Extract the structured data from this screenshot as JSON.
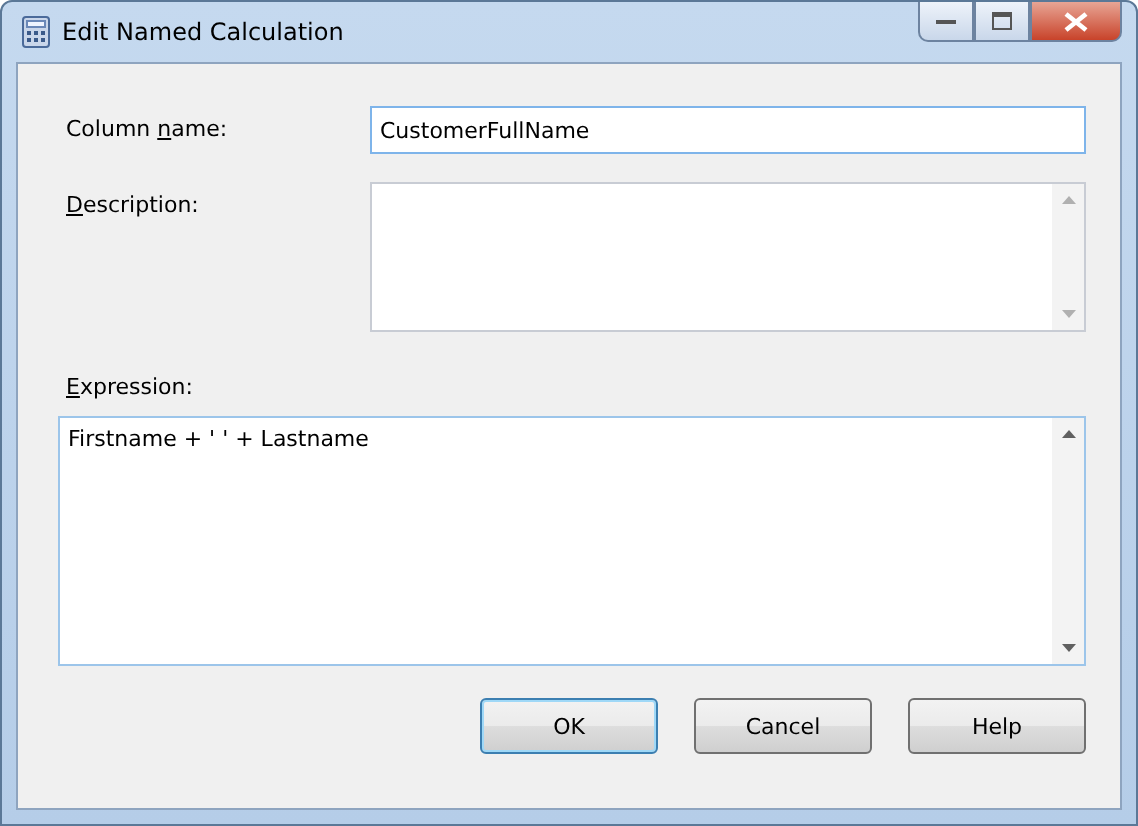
{
  "window": {
    "title": "Edit Named Calculation"
  },
  "fields": [
    {
      "kind": "line",
      "label": [
        {
          "text": "Column ",
          "key": false
        },
        {
          "text": "n",
          "key": true
        },
        {
          "text": "ame:",
          "key": false
        }
      ],
      "value": "CustomerFullName"
    },
    {
      "kind": "memo",
      "label": [
        {
          "text": "D",
          "key": true
        },
        {
          "text": "escription:",
          "key": false
        }
      ]
    }
  ],
  "expression": {
    "label": [
      {
        "text": "E",
        "key": true
      },
      {
        "text": "xpression:",
        "key": false
      }
    ],
    "value": "Firstname + ' ' + Lastname"
  },
  "buttons": [
    {
      "label": "OK",
      "default": true
    },
    {
      "label": "Cancel",
      "default": false
    },
    {
      "label": "Help",
      "default": false
    }
  ]
}
